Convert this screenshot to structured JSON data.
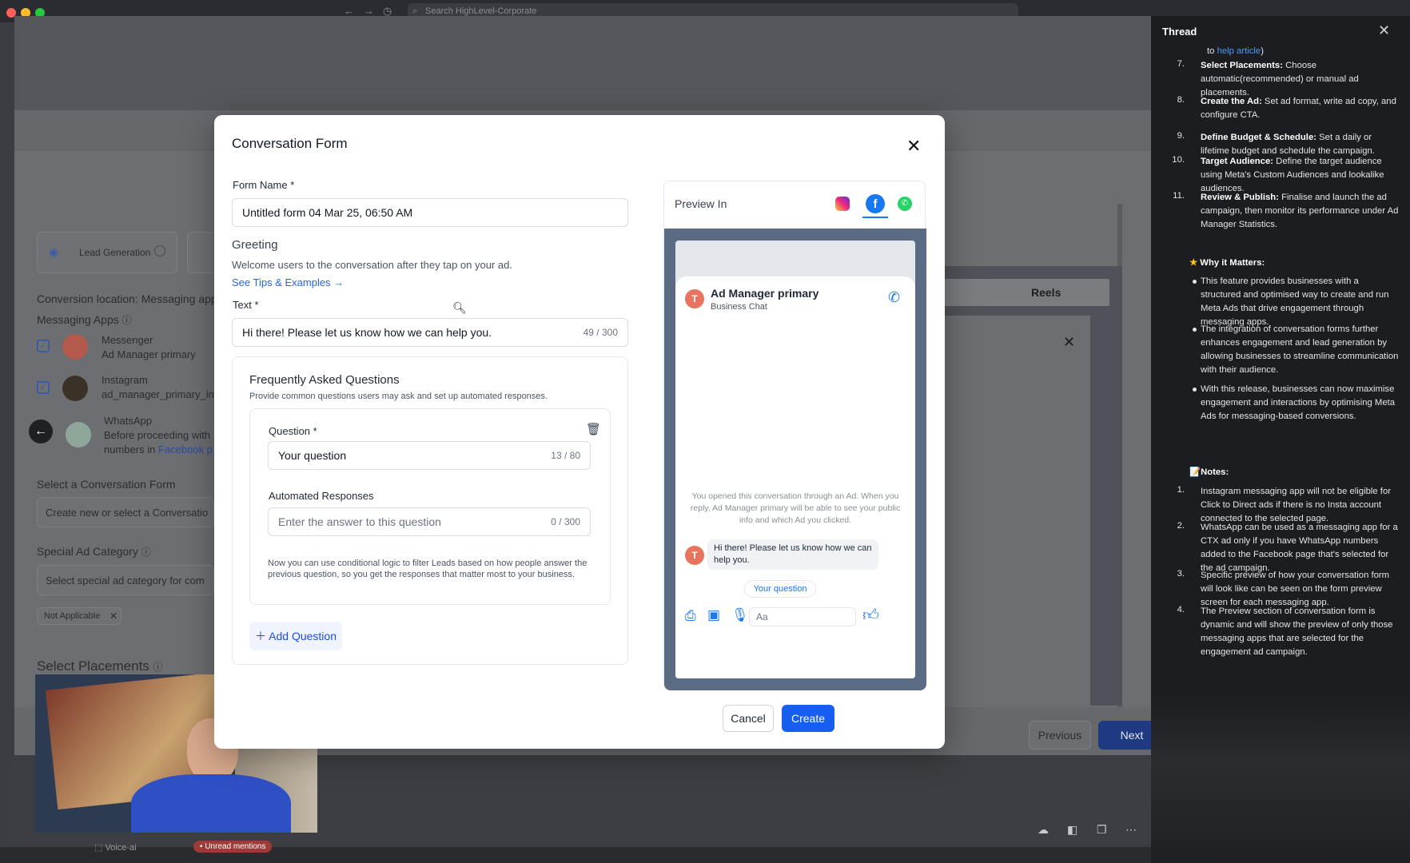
{
  "browser": {
    "search_placeholder": "Search HighLevel-Corporate"
  },
  "background": {
    "chip_lead_generation": "Lead Generation",
    "conversion_location_label": "Conversion location:",
    "conversion_location_value": "Messaging app",
    "messaging_apps_label": "Messaging Apps",
    "messenger_name": "Messenger",
    "messenger_account": "Ad Manager primary",
    "instagram_name": "Instagram",
    "instagram_account": "ad_manager_primary_in",
    "whatsapp_name": "WhatsApp",
    "whatsapp_note_1": "Before proceeding with",
    "whatsapp_note_2": "numbers in",
    "whatsapp_note_link": "Facebook p",
    "select_form_label": "Select a Conversation Form",
    "select_form_placeholder": "Create new or select a Conversatio",
    "special_ad_label": "Special Ad Category",
    "special_ad_placeholder": "Select special ad category for com",
    "not_applicable_chip": "Not Applicable",
    "select_placements_label": "Select Placements",
    "reels_tab": "Reels",
    "previous_button": "Previous",
    "next_button": "Next",
    "bottom_voice_ai": "Voice-ai",
    "bottom_unread": "Unread mentions"
  },
  "modal": {
    "title": "Conversation Form",
    "form_name_label": "Form Name *",
    "form_name_value": "Untitled form 04 Mar 25, 06:50 AM",
    "greeting_heading": "Greeting",
    "greeting_desc": "Welcome users to the conversation after they tap on your ad.",
    "tips_link": "See Tips & Examples",
    "text_label": "Text *",
    "text_value": "Hi there! Please let us know how we can help you.",
    "text_count": "49 / 300",
    "faq_heading": "Frequently Asked Questions",
    "faq_desc": "Provide common questions users may ask and set up automated responses.",
    "question_label": "Question *",
    "question_value": "Your question",
    "question_count": "13 / 80",
    "auto_label": "Automated Responses",
    "answer_placeholder": "Enter the answer to this question",
    "answer_count": "0 / 300",
    "logic_note": "Now you can use conditional logic to filter Leads based on how people answer the previous question, so you get the responses that matter most to your business.",
    "add_question": "Add Question",
    "cancel": "Cancel",
    "create": "Create"
  },
  "preview": {
    "label": "Preview In",
    "page_name": "Ad Manager primary",
    "page_sub": "Business Chat",
    "avatar_letter": "T",
    "notice": "You opened this conversation through an Ad. When you reply, Ad Manager primary will be able to see your public info and which Ad you clicked.",
    "message": "Hi there! Please let us know how we can help you.",
    "quick_reply": "Your question",
    "compose_placeholder": "Aa"
  },
  "thread": {
    "title": "Thread",
    "top_line_prefix": "to",
    "top_line_link": "help article",
    "top_line_suffix": ")",
    "steps": [
      {
        "num": "7.",
        "bold": "Select Placements:",
        "text": "Choose automatic(recommended) or manual ad placements."
      },
      {
        "num": "8.",
        "bold": "Create the Ad:",
        "text": "Set ad format, write ad copy, and configure CTA."
      },
      {
        "num": "9.",
        "bold": "Define Budget & Schedule:",
        "text": "Set a daily or lifetime budget and schedule the campaign."
      },
      {
        "num": "10.",
        "bold": "Target Audience:",
        "text": "Define the target audience using Meta's Custom Audiences and lookalike audiences."
      },
      {
        "num": "11.",
        "bold": "Review & Publish:",
        "text": "Finalise and launch the ad campaign, then monitor its performance under Ad Manager Statistics."
      }
    ],
    "why_heading": "Why it Matters:",
    "why": [
      "This feature provides businesses with a structured and optimised way to create and run Meta Ads that drive engagement through messaging apps.",
      "The integration of conversation forms further enhances engagement and lead generation by allowing businesses to streamline communication with their audience.",
      "With this release, businesses can now maximise engagement and interactions by optimising Meta Ads for messaging-based conversions."
    ],
    "notes_heading": "Notes:",
    "notes": [
      {
        "num": "1.",
        "text": "Instagram messaging app will not be eligible for Click to Direct ads if there is no Insta account connected to the selected page."
      },
      {
        "num": "2.",
        "text": "WhatsApp can be used as a messaging app for a CTX ad only if you have WhatsApp numbers added to the Facebook page that's selected for the ad campaign."
      },
      {
        "num": "3.",
        "text": "Specific preview of how your conversation form will look like can be seen on the form preview screen for each messaging app."
      },
      {
        "num": "4.",
        "text": "The Preview section of conversation form is dynamic and will show the preview of only those messaging apps that are selected for the engagement ad campaign."
      }
    ]
  },
  "colors": {
    "primary": "#155eef",
    "facebook": "#1877f2",
    "whatsapp": "#25d366",
    "avatar": "#e8735f"
  }
}
